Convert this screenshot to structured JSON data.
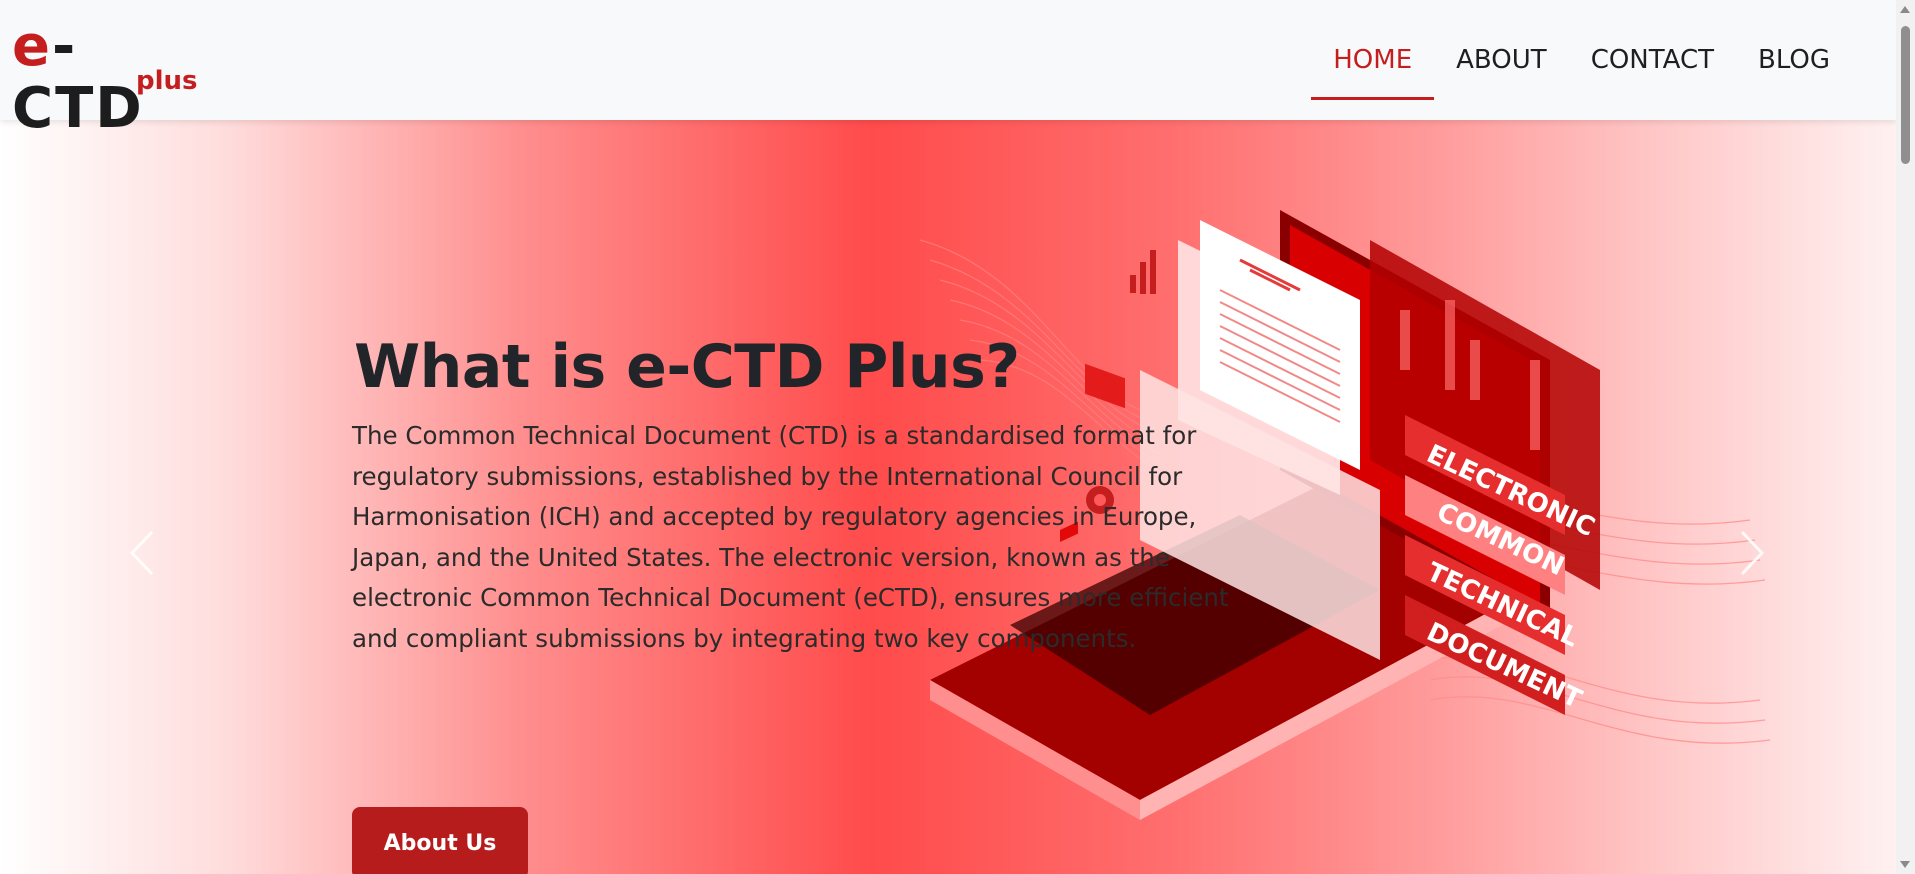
{
  "header": {
    "logo": {
      "main_prefix": "e",
      "main_rest": "-CTD",
      "sub": "plus"
    },
    "nav": [
      {
        "label": "HOME",
        "active": true
      },
      {
        "label": "ABOUT",
        "active": false
      },
      {
        "label": "CONTACT",
        "active": false
      },
      {
        "label": "BLOG",
        "active": false
      }
    ]
  },
  "hero": {
    "title": "What is e-CTD Plus?",
    "body": "The Common Technical Document (CTD) is a standardised format for regulatory submissions, established by the International Council for Harmonisation (ICH) and accepted by regulatory agencies in Europe, Japan, and the United States. The electronic version, known as the electronic Common Technical Document (eCTD), ensures more efficient and compliant submissions by integrating two key components.",
    "button_label": "About Us",
    "illustration_tags": [
      "ELECTRONIC",
      "COMMON",
      "TECHNICAL",
      "DOCUMENT"
    ]
  },
  "colors": {
    "brand_red": "#c41e1e",
    "button_red": "#b71c1c",
    "hero_center": "#ff4b4b"
  },
  "icons": {
    "prev": "chevron-left-icon",
    "next": "chevron-right-icon"
  }
}
